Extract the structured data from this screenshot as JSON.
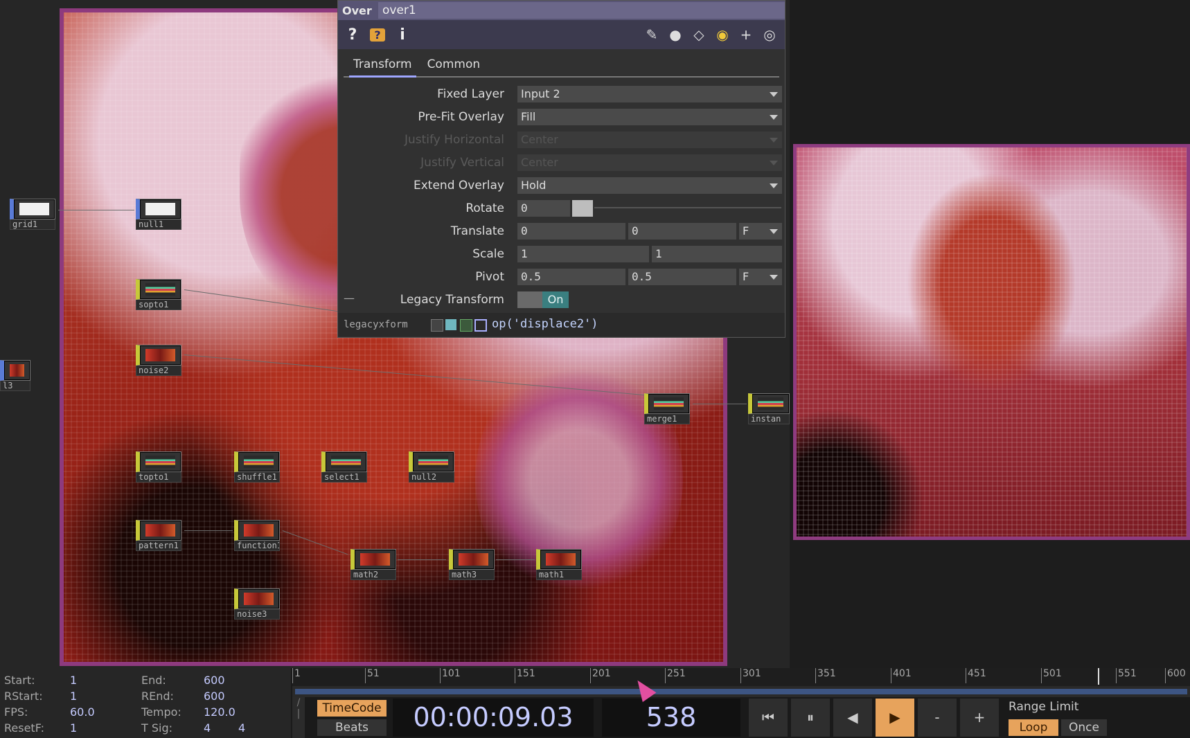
{
  "params": {
    "op_type": "Over",
    "op_name": "over1",
    "toolbar_icons": [
      "help-icon",
      "python-help-icon",
      "info-icon"
    ],
    "toolbar_right_icons": [
      "pencil-icon",
      "comment-icon",
      "clone-icon",
      "python-icon",
      "plus-icon",
      "target-icon"
    ],
    "tabs": [
      {
        "label": "Transform"
      },
      {
        "label": "Common"
      }
    ],
    "active_tab": "Transform",
    "fixed_layer": {
      "label": "Fixed Layer",
      "value": "Input 2"
    },
    "prefit": {
      "label": "Pre-Fit Overlay",
      "value": "Fill"
    },
    "justify_h": {
      "label": "Justify Horizontal",
      "value": "Center"
    },
    "justify_v": {
      "label": "Justify Vertical",
      "value": "Center"
    },
    "extend": {
      "label": "Extend Overlay",
      "value": "Hold"
    },
    "rotate": {
      "label": "Rotate",
      "value": "0"
    },
    "translate": {
      "label": "Translate",
      "x": "0",
      "y": "0",
      "unit": "F"
    },
    "scale": {
      "label": "Scale",
      "x": "1",
      "y": "1"
    },
    "pivot": {
      "label": "Pivot",
      "x": "0.5",
      "y": "0.5",
      "unit": "F"
    },
    "legacy": {
      "label": "Legacy Transform",
      "value": "On",
      "collapse": "—"
    },
    "legacyxform": {
      "name": "legacyxform",
      "expr": "op('displace2')"
    }
  },
  "nodes": [
    {
      "label": "grid1"
    },
    {
      "label": "null1"
    },
    {
      "label": "sopto1"
    },
    {
      "label": "noise2"
    },
    {
      "label": "l3"
    },
    {
      "label": "topto1"
    },
    {
      "label": "shuffle1"
    },
    {
      "label": "select1"
    },
    {
      "label": "null2"
    },
    {
      "label": "merge1"
    },
    {
      "label": "instan"
    },
    {
      "label": "pattern1"
    },
    {
      "label": "function1"
    },
    {
      "label": "math2"
    },
    {
      "label": "math3"
    },
    {
      "label": "math1"
    },
    {
      "label": "noise3"
    }
  ],
  "timeline": {
    "start_label": "Start:",
    "start": "1",
    "end_label": "End:",
    "end": "600",
    "rstart_label": "RStart:",
    "rstart": "1",
    "rend_label": "REnd:",
    "rend": "600",
    "fps_label": "FPS:",
    "fps": "60.0",
    "tempo_label": "Tempo:",
    "tempo": "120.0",
    "resetf_label": "ResetF:",
    "resetf": "1",
    "tsig_label": "T Sig:",
    "tsig_a": "4",
    "tsig_b": "4",
    "ticks": [
      "1",
      "51",
      "101",
      "151",
      "201",
      "251",
      "301",
      "351",
      "401",
      "451",
      "501",
      "551",
      "600"
    ],
    "timecode_btn": "TimeCode",
    "beats_btn": "Beats",
    "timecode": "00:00:09.03",
    "frame": "538",
    "range_limit": "Range Limit",
    "loop": "Loop",
    "once": "Once",
    "transport": {
      "rewind": "⏮",
      "pause": "⏸",
      "step_back": "◀",
      "play": "▶",
      "minus": "-",
      "plus": "+"
    }
  }
}
